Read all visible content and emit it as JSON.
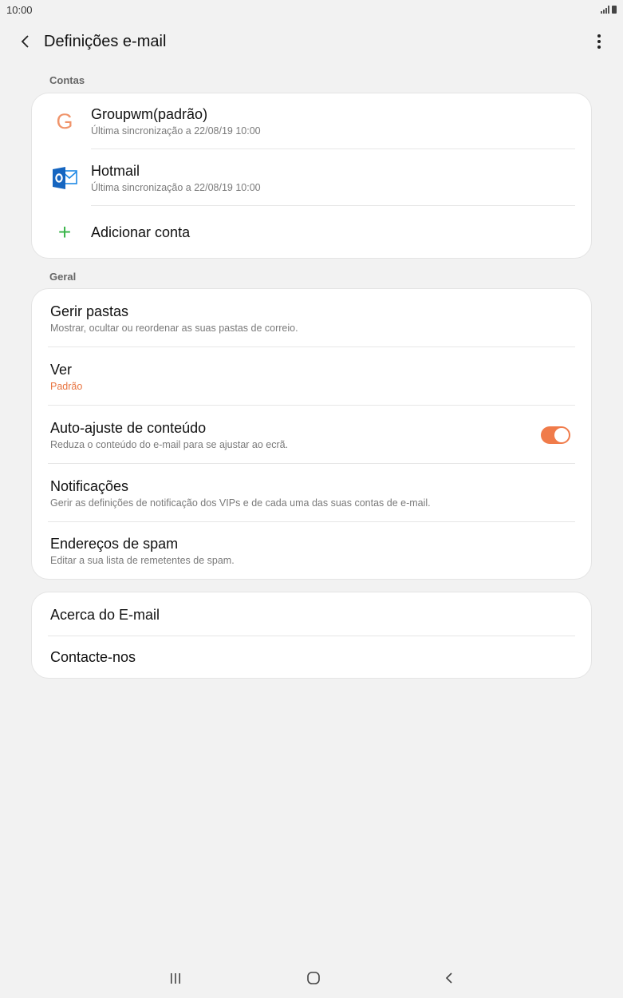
{
  "status_bar": {
    "time": "10:00"
  },
  "app_bar": {
    "title": "Definições e-mail"
  },
  "sections": {
    "accounts_label": "Contas",
    "general_label": "Geral"
  },
  "accounts": [
    {
      "name": "Groupwm(padrão)",
      "subtitle": "Última sincronização a 22/08/19  10:00",
      "icon": "G"
    },
    {
      "name": "Hotmail",
      "subtitle": "Última sincronização a 22/08/19  10:00",
      "icon": "outlook-icon"
    }
  ],
  "add_account": {
    "label": "Adicionar conta"
  },
  "general": [
    {
      "title": "Gerir pastas",
      "subtitle": "Mostrar, ocultar ou reordenar as suas pastas de correio."
    },
    {
      "title": "Ver",
      "subtitle": "Padrão"
    },
    {
      "title": "Auto-ajuste de conteúdo",
      "subtitle": "Reduza o conteúdo do e-mail para se ajustar ao ecrã.",
      "toggle_on": true
    },
    {
      "title": "Notificações",
      "subtitle": "Gerir as definições de notificação dos VIPs e de cada uma das suas contas de e-mail."
    },
    {
      "title": "Endereços de spam",
      "subtitle": "Editar a sua lista de remetentes de spam."
    }
  ],
  "about": [
    {
      "title": "Acerca do E-mail"
    },
    {
      "title": "Contacte-nos"
    }
  ],
  "colors": {
    "accent": "#f07b4a",
    "add_green": "#3ab54a",
    "outlook_blue": "#1565c0"
  }
}
